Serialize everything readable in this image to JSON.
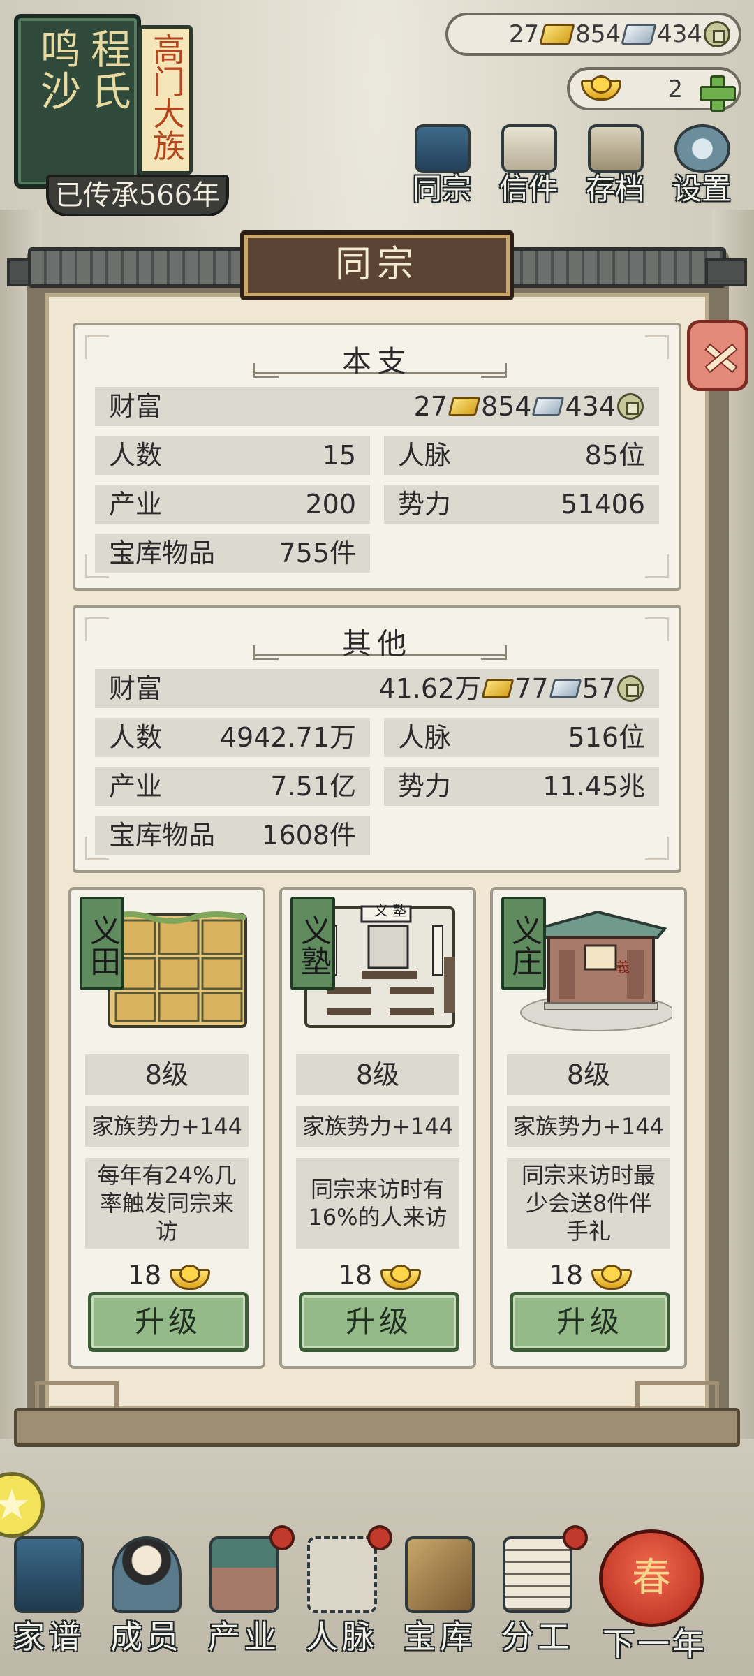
{
  "plaque": {
    "family_name": "程氏",
    "region": "鸣沙",
    "rank": "高门大族",
    "generations": "已传承566年"
  },
  "currency": {
    "gold": "27",
    "silver": "854",
    "coin": "434",
    "yuanbao": "2"
  },
  "top_menu": [
    {
      "label": "同宗",
      "icon": "clan-book-icon"
    },
    {
      "label": "信件",
      "icon": "letters-icon"
    },
    {
      "label": "存档",
      "icon": "save-scroll-icon"
    },
    {
      "label": "设置",
      "icon": "gear-icon"
    }
  ],
  "panel": {
    "title": "同宗"
  },
  "main_branch": {
    "title": "本支",
    "wealth_label": "财富",
    "wealth_gold": "27",
    "wealth_silver": "854",
    "wealth_coin": "434",
    "rows": [
      {
        "label": "人数",
        "value": "15"
      },
      {
        "label": "人脉",
        "value": "85位"
      },
      {
        "label": "产业",
        "value": "200"
      },
      {
        "label": "势力",
        "value": "51406"
      },
      {
        "label": "宝库物品",
        "value": "755件"
      }
    ]
  },
  "others": {
    "title": "其他",
    "wealth_label": "财富",
    "wealth_gold": "41.62万",
    "wealth_silver": "77",
    "wealth_coin": "57",
    "rows": [
      {
        "label": "人数",
        "value": "4942.71万"
      },
      {
        "label": "人脉",
        "value": "516位"
      },
      {
        "label": "产业",
        "value": "7.51亿"
      },
      {
        "label": "势力",
        "value": "11.45兆"
      },
      {
        "label": "宝库物品",
        "value": "1608件"
      }
    ]
  },
  "buildings": [
    {
      "name": "义田",
      "level": "8级",
      "bonus": "家族势力+144",
      "description": "每年有24%几率触发同宗来访",
      "cost": "18",
      "button": "升级"
    },
    {
      "name": "义塾",
      "level": "8级",
      "bonus": "家族势力+144",
      "description": "同宗来访时有16%的人来访",
      "cost": "18",
      "button": "升级",
      "sign": "义 塾"
    },
    {
      "name": "义庄",
      "level": "8级",
      "bonus": "家族势力+144",
      "description": "同宗来访时最少会送8件伴手礼",
      "cost": "18",
      "button": "升级",
      "sign": "義"
    }
  ],
  "bottom_nav": [
    {
      "label": "家谱",
      "icon": "genealogy-book-icon"
    },
    {
      "label": "成员",
      "icon": "member-portrait-icon"
    },
    {
      "label": "产业",
      "icon": "building-icon"
    },
    {
      "label": "人脉",
      "icon": "network-icon"
    },
    {
      "label": "宝库",
      "icon": "treasure-chest-icon"
    },
    {
      "label": "分工",
      "icon": "scroll-icon"
    },
    {
      "label": "下一年",
      "icon": "lantern-icon"
    }
  ],
  "lantern_char": "春",
  "colors": {
    "accent_green": "#96b989",
    "close_red": "#e3897a",
    "title_brown": "#5b4433",
    "paper": "#efe7d2"
  }
}
